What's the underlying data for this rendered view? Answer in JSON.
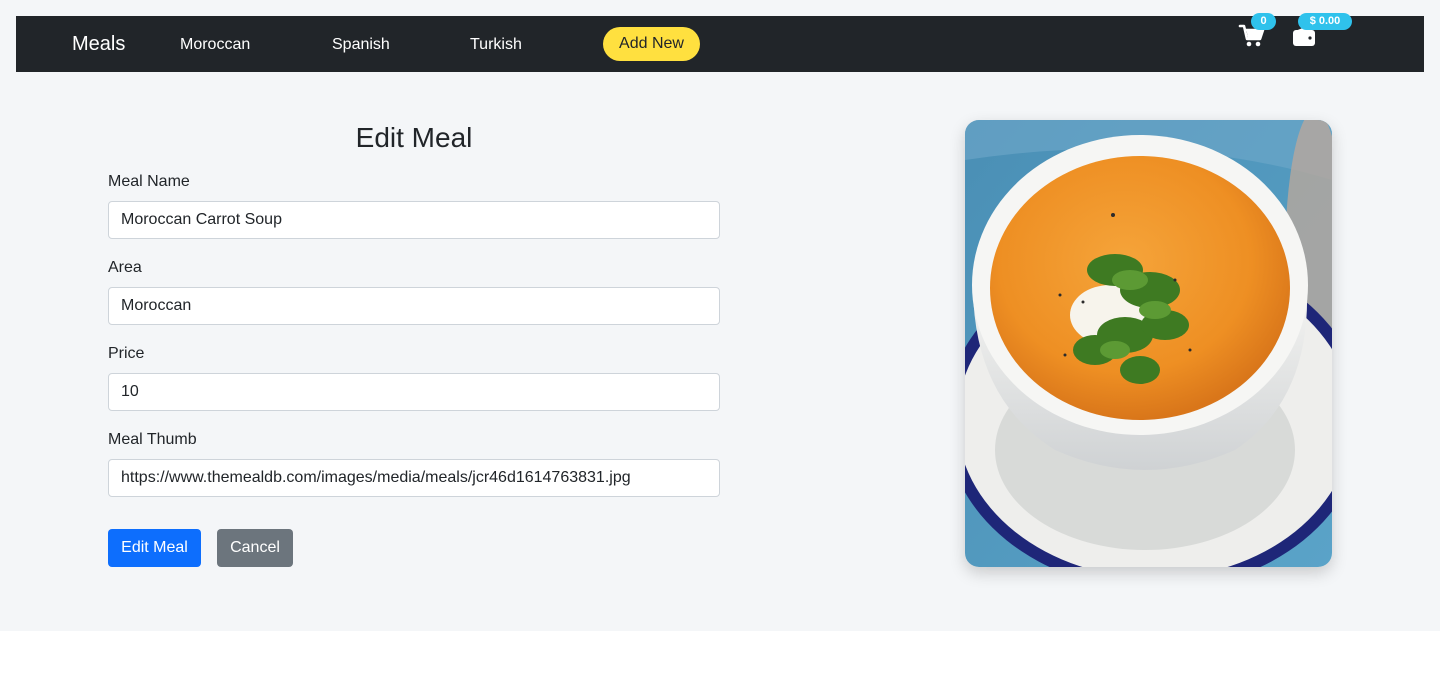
{
  "navbar": {
    "brand": "Meals",
    "links": [
      "Moroccan",
      "Spanish",
      "Turkish"
    ],
    "add_new": "Add New",
    "cart_count": "0",
    "wallet_amount": "$ 0.00",
    "cart_icon": "cart-icon",
    "wallet_icon": "wallet-icon",
    "badge_color": "#2fc2ec",
    "add_new_color": "#ffe03f"
  },
  "form": {
    "title": "Edit Meal",
    "fields": [
      {
        "label": "Meal Name",
        "value": "Moroccan Carrot Soup"
      },
      {
        "label": "Area",
        "value": "Moroccan"
      },
      {
        "label": "Price",
        "value": "10"
      },
      {
        "label": "Meal Thumb",
        "value": "https://www.themealdb.com/images/media/meals/jcr46d1614763831.jpg"
      }
    ],
    "submit_label": "Edit Meal",
    "cancel_label": "Cancel",
    "submit_color": "#0d6efd",
    "cancel_color": "#6c757d"
  },
  "image": {
    "subject": "carrot soup in white bowl with cilantro"
  }
}
